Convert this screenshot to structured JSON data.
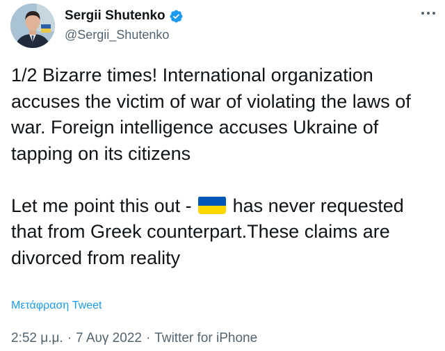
{
  "author": {
    "display_name": "Sergii Shutenko",
    "handle": "@Sergii_Shutenko",
    "verified": true
  },
  "more_icon": "more-horizontal-icon",
  "tweet": {
    "para1": "1/2 Bizarre times! International organization accuses the victim of war of violating the laws of war. Foreign intelligence accuses Ukraine of tapping on its citizens",
    "para2_before": "Let me point this out - ",
    "para2_emoji": "ukraine-flag-icon",
    "para2_after": " has never requested that from Greek counterpart.These claims are divorced from reality"
  },
  "translate_label": "Μετάφραση Tweet",
  "meta": {
    "time": "2:52 μ.μ.",
    "sep1": "·",
    "date": "7 Αυγ 2022",
    "sep2": "·",
    "source": "Twitter for iPhone"
  },
  "colors": {
    "link": "#1d9bf0",
    "secondary_text": "#536471",
    "verified_badge": "#1d9bf0",
    "flag_blue": "#0057b7",
    "flag_yellow": "#ffd700"
  }
}
